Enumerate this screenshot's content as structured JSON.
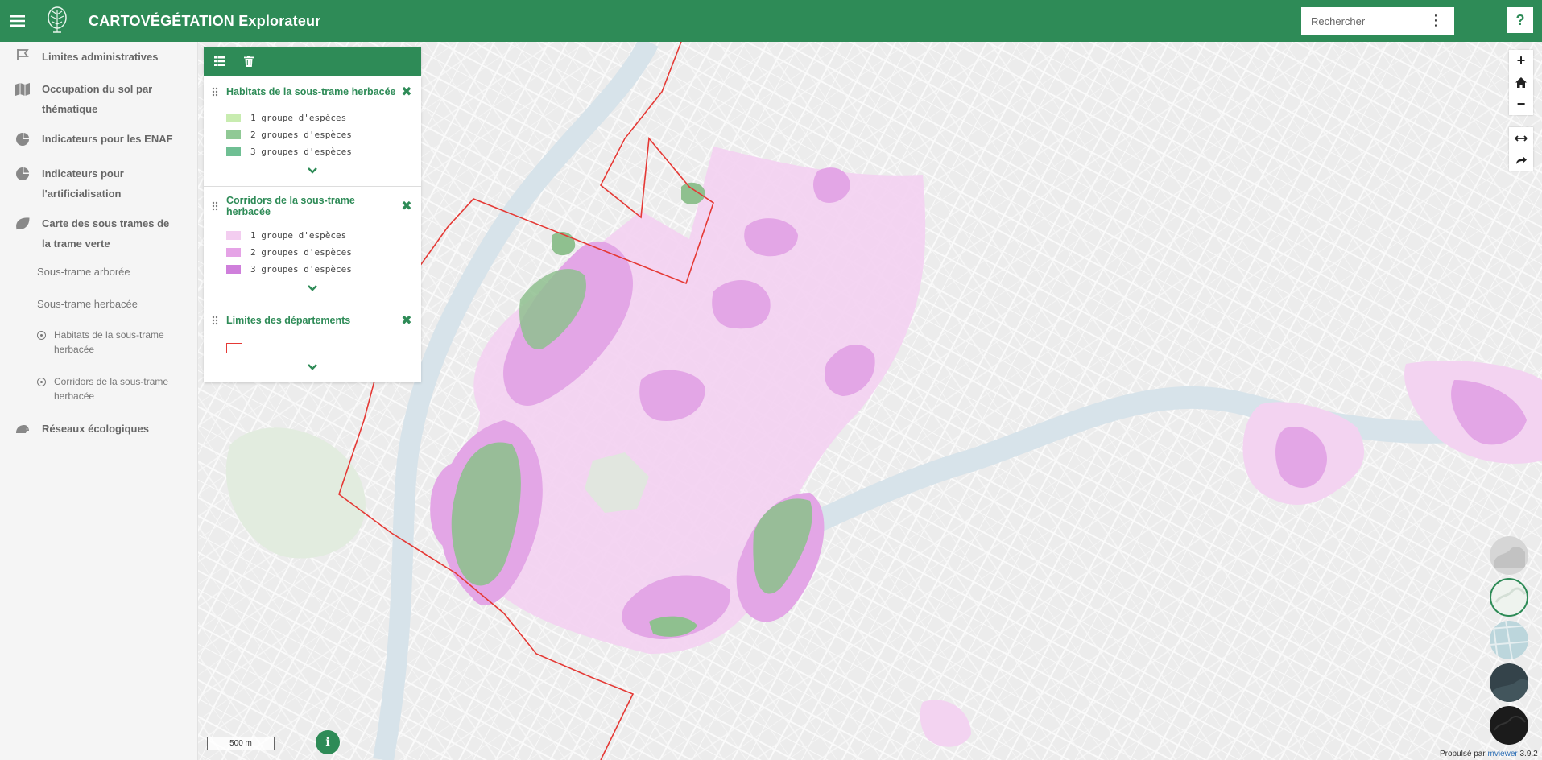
{
  "app": {
    "title": "CARTOVÉGÉTATION Explorateur",
    "menu_icon": "hamburger-icon",
    "logo_icon": "tree-logo-icon",
    "accent_color": "#2e8b57"
  },
  "search": {
    "placeholder": "Rechercher",
    "options_icon": "kebab-icon"
  },
  "help": {
    "label": "?"
  },
  "sidebar": {
    "items": [
      {
        "label": "Limites administratives",
        "icon": "flag-icon"
      },
      {
        "label": "Occupation du sol par thématique",
        "icon": "map-icon"
      },
      {
        "label": "Indicateurs pour les ENAF",
        "icon": "pie-chart-icon"
      },
      {
        "label": "Indicateurs pour l'artificialisation",
        "icon": "pie-chart-icon"
      },
      {
        "label": "Carte des sous trames de la trame verte",
        "icon": "leaf-icon"
      },
      {
        "label": "Réseaux écologiques",
        "icon": "hedgehog-icon"
      }
    ],
    "subitems": [
      {
        "label": "Sous-trame arborée"
      },
      {
        "label": "Sous-trame herbacée"
      }
    ],
    "subsubitems": [
      {
        "label": "Habitats de la sous-trame herbacée"
      },
      {
        "label": "Corridors de la sous-trame herbacée"
      }
    ]
  },
  "legend": {
    "toolbar": {
      "list_icon": "list-icon",
      "trash_icon": "trash-icon"
    },
    "cards": [
      {
        "title": "Habitats de la sous-trame herbacée",
        "rows": [
          {
            "label": "1 groupe d'espèces",
            "color": "#c8ecb0"
          },
          {
            "label": "2 groupes d'espèces",
            "color": "#90c995"
          },
          {
            "label": "3 groupes d'espèces",
            "color": "#6fbf93"
          }
        ]
      },
      {
        "title": "Corridors de la sous-trame herbacée",
        "rows": [
          {
            "label": "1 groupe d'espèces",
            "color": "#f3cdf0"
          },
          {
            "label": "2 groupes d'espèces",
            "color": "#e5a3e6"
          },
          {
            "label": "3 groupes d'espèces",
            "color": "#cf7fdb"
          }
        ]
      },
      {
        "title": "Limites des départements",
        "boundary_color": "#e53935"
      }
    ]
  },
  "map_controls": {
    "zoom_in": "+",
    "home_icon": "home-icon",
    "zoom_out": "−",
    "measure_icon": "measure-icon",
    "share_icon": "share-icon"
  },
  "basemaps": [
    {
      "name": "grey-basemap-icon",
      "color": "#d6d6d6"
    },
    {
      "name": "light-basemap-icon",
      "color": "#eef3ee"
    },
    {
      "name": "blue-basemap-icon",
      "color": "#bcd6dc"
    },
    {
      "name": "dark-photo-basemap-icon",
      "color": "#34434a"
    },
    {
      "name": "black-basemap-icon",
      "color": "#1b1b1b"
    }
  ],
  "scale": {
    "label": "500 m"
  },
  "info": {
    "label": "i"
  },
  "credit": {
    "prefix": "Propulsé par ",
    "link": "mviewer",
    "version": " 3.9.2"
  }
}
